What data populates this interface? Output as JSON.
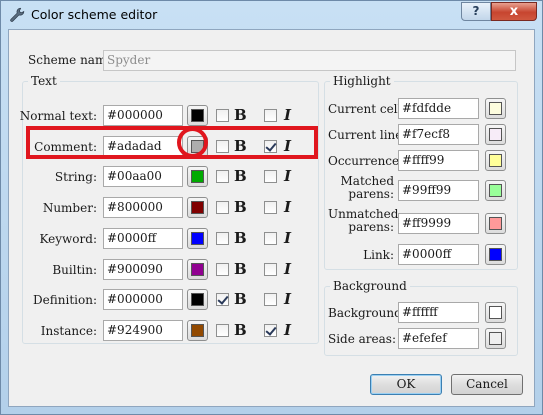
{
  "window": {
    "title": "Color scheme editor",
    "help_label": "?",
    "close_label": "x"
  },
  "scheme_name": {
    "label": "Scheme name:",
    "value": "Spyder"
  },
  "text_group": {
    "title": "Text",
    "rows": [
      {
        "label": "Normal text:",
        "value": "#000000",
        "color": "#000000",
        "bold": false,
        "italic": false
      },
      {
        "label": "Comment:",
        "value": "#adadad",
        "color": "#adadad",
        "bold": false,
        "italic": true
      },
      {
        "label": "String:",
        "value": "#00aa00",
        "color": "#00aa00",
        "bold": false,
        "italic": false
      },
      {
        "label": "Number:",
        "value": "#800000",
        "color": "#800000",
        "bold": false,
        "italic": false
      },
      {
        "label": "Keyword:",
        "value": "#0000ff",
        "color": "#0000ff",
        "bold": false,
        "italic": false
      },
      {
        "label": "Builtin:",
        "value": "#900090",
        "color": "#900090",
        "bold": false,
        "italic": false
      },
      {
        "label": "Definition:",
        "value": "#000000",
        "color": "#000000",
        "bold": true,
        "italic": false
      },
      {
        "label": "Instance:",
        "value": "#924900",
        "color": "#924900",
        "bold": false,
        "italic": true
      }
    ],
    "bold_glyph": "B",
    "italic_glyph": "I"
  },
  "highlight_group": {
    "title": "Highlight",
    "rows": [
      {
        "label": "Current cell:",
        "value": "#fdfdde",
        "color": "#fdfdde"
      },
      {
        "label": "Current line:",
        "value": "#f7ecf8",
        "color": "#f7ecf8"
      },
      {
        "label": "Occurrence:",
        "value": "#ffff99",
        "color": "#ffff99"
      },
      {
        "label": "Matched parens:",
        "value": "#99ff99",
        "color": "#99ff99"
      },
      {
        "label": "Unmatched parens:",
        "value": "#ff9999",
        "color": "#ff9999"
      },
      {
        "label": "Link:",
        "value": "#0000ff",
        "color": "#0000ff"
      }
    ]
  },
  "background_group": {
    "title": "Background",
    "rows": [
      {
        "label": "Background:",
        "value": "#ffffff",
        "color": "#ffffff"
      },
      {
        "label": "Side areas:",
        "value": "#efefef",
        "color": "#efefef"
      }
    ]
  },
  "buttons": {
    "ok_label": "OK",
    "cancel_label": "Cancel"
  },
  "annotation": {
    "color": "#e0161e"
  }
}
